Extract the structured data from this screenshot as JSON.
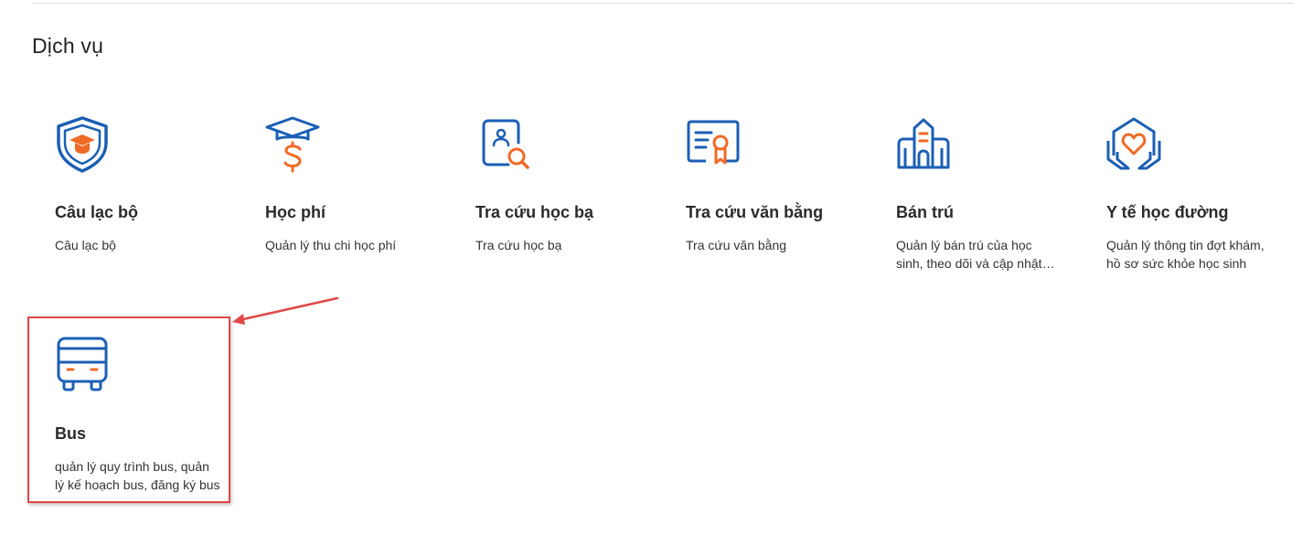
{
  "section": {
    "title": "Dịch vụ"
  },
  "colors": {
    "primary_blue": "#1b5fb5",
    "accent_orange": "#ef6a25",
    "highlight_red": "#e04848"
  },
  "services": [
    {
      "icon": "shield-graduation-cap-icon",
      "title": "Câu lạc bộ",
      "description": "Câu lạc bộ"
    },
    {
      "icon": "graduation-cap-dollar-icon",
      "title": "Học phí",
      "description": "Quản lý thu chi học phí"
    },
    {
      "icon": "student-record-search-icon",
      "title": "Tra cứu học bạ",
      "description": "Tra cứu học bạ"
    },
    {
      "icon": "certificate-icon",
      "title": "Tra cứu văn bằng",
      "description": "Tra cứu văn bằng"
    },
    {
      "icon": "school-building-icon",
      "title": "Bán trú",
      "description": "Quản lý bán trú của học sinh, theo dõi và cập nhật thông tin bán trú"
    },
    {
      "icon": "heart-care-icon",
      "title": "Y tế học đường",
      "description": "Quản lý thông tin đợt khám, hồ sơ sức khỏe học sinh"
    },
    {
      "icon": "bus-icon",
      "title": "Bus",
      "description": "quản lý quy trình bus, quản lý kế hoạch bus, đăng ký bus"
    }
  ]
}
